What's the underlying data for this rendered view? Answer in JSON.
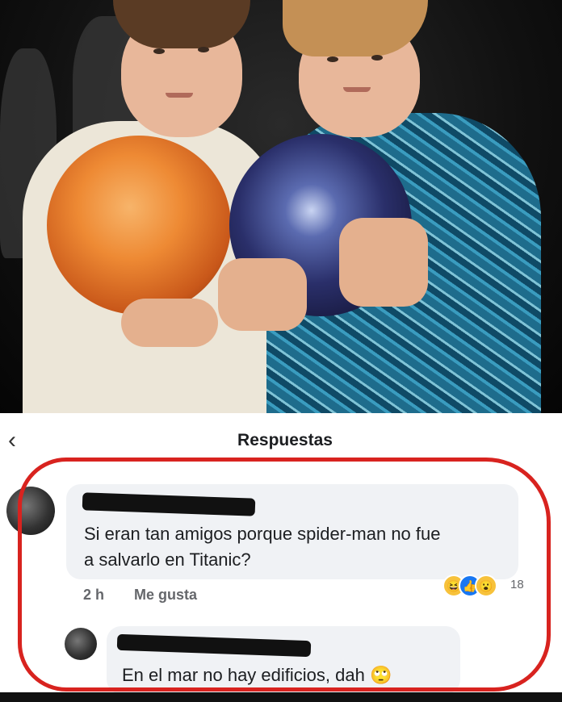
{
  "header": {
    "title": "Respuestas"
  },
  "comment": {
    "text_line1": "Si eran tan amigos porque spider-man no fue",
    "text_line2": "a salvarlo en Titanic?",
    "time": "2 h",
    "like_label": "Me gusta",
    "reaction_count": "18",
    "reactions": [
      "haha",
      "like",
      "wow"
    ]
  },
  "reply": {
    "text": "En el mar no hay edificios, dah",
    "emoji": "🙄"
  },
  "colors": {
    "highlight": "#d8231f",
    "like": "#1877f2",
    "reaction_yellow": "#f7c23b"
  }
}
